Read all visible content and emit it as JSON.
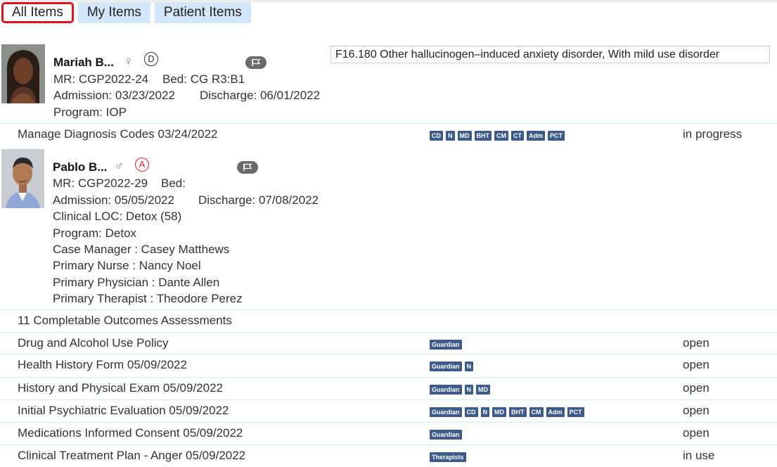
{
  "tabs": [
    {
      "label": "All Items",
      "active": true
    },
    {
      "label": "My Items",
      "active": false
    },
    {
      "label": "Patient Items",
      "active": false
    }
  ],
  "patient1": {
    "name": "Mariah B...",
    "sex_symbol": "♀",
    "status_badge": "D",
    "mr": "MR: CGP2022-24",
    "bed": "Bed: CG R3:B1",
    "admission": "Admission: 03/23/2022",
    "discharge": "Discharge: 06/01/2022",
    "program": "Program: IOP",
    "diagnosis": "F16.180 Other hallucinogen–induced anxiety disorder, With mild use disorder"
  },
  "patient1_rows": [
    {
      "title": "Manage Diagnosis Codes 03/24/2022",
      "tags": [
        "CD",
        "N",
        "MD",
        "BHT",
        "CM",
        "CT",
        "Adm",
        "PCT"
      ],
      "status": "in progress"
    }
  ],
  "patient2": {
    "name": "Pablo B...",
    "sex_symbol": "♂",
    "status_badge": "A",
    "mr": "MR: CGP2022-29",
    "bed": "Bed:",
    "admission": "Admission: 05/05/2022",
    "discharge": "Discharge: 07/08/2022",
    "clinical_loc": "Clinical LOC: Detox (58)",
    "program": "Program: Detox",
    "case_manager": "Case Manager  :  Casey Matthews",
    "primary_nurse": "Primary Nurse  :  Nancy Noel",
    "primary_physician": "Primary Physician  :  Dante Allen",
    "primary_therapist": "Primary Therapist  :  Theodore Perez"
  },
  "patient2_rows": [
    {
      "title": "11 Completable Outcomes Assessments",
      "tags": [],
      "status": ""
    },
    {
      "title": "Drug and Alcohol Use Policy",
      "tags": [
        "Guardian"
      ],
      "status": "open"
    },
    {
      "title": "Health History Form 05/09/2022",
      "tags": [
        "Guardian",
        "N"
      ],
      "status": "open"
    },
    {
      "title": "History and Physical Exam 05/09/2022",
      "tags": [
        "Guardian",
        "N",
        "MD"
      ],
      "status": "open"
    },
    {
      "title": "Initial Psychiatric Evaluation 05/09/2022",
      "tags": [
        "Guardian",
        "CD",
        "N",
        "MD",
        "BHT",
        "CM",
        "Adm",
        "PCT"
      ],
      "status": "open"
    },
    {
      "title": "Medications Informed Consent 05/09/2022",
      "tags": [
        "Guardian"
      ],
      "status": "open"
    },
    {
      "title": "Clinical Treatment Plan - Anger 05/09/2022",
      "tags": [
        "Therapists"
      ],
      "status": "in use"
    }
  ],
  "colors": {
    "tag_bg": "#3d5a8a",
    "tab_bg": "#d4e6f9",
    "active_border": "#e0141e",
    "badge_red": "#d9232d"
  },
  "icons": {
    "flag": "flag-icon",
    "female": "female-symbol-icon",
    "male": "male-symbol-icon"
  }
}
